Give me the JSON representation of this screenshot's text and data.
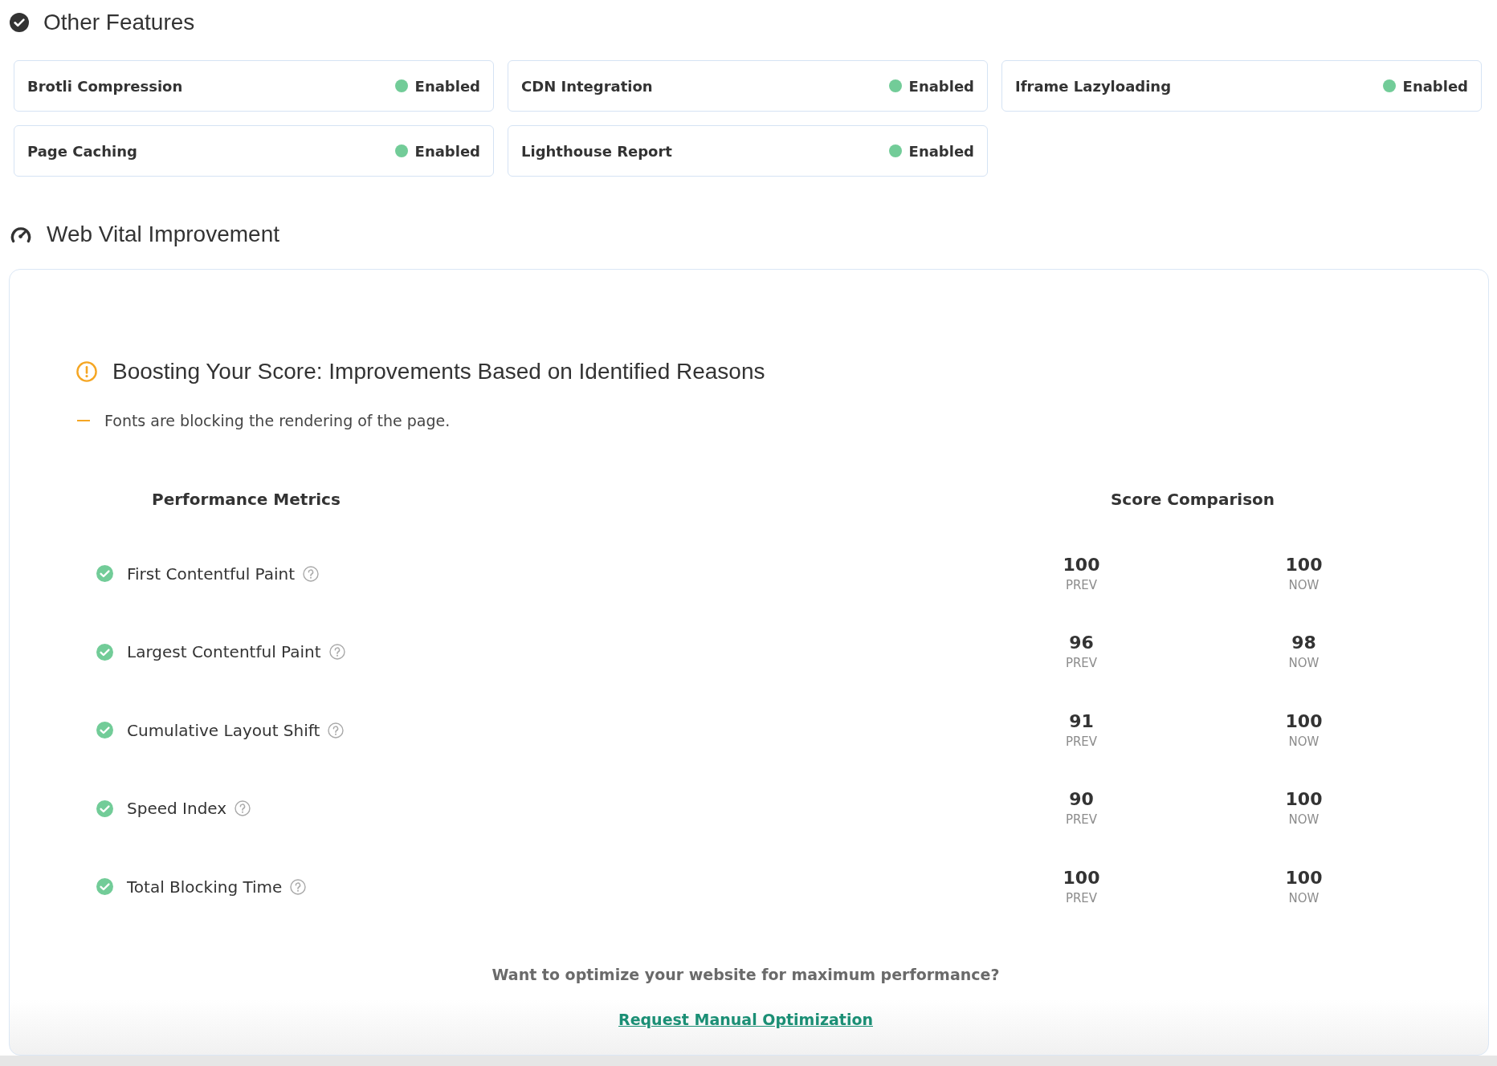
{
  "other_features": {
    "title": "Other Features",
    "items": [
      {
        "name": "Brotli Compression",
        "status": "Enabled",
        "enabled": true
      },
      {
        "name": "CDN Integration",
        "status": "Enabled",
        "enabled": true
      },
      {
        "name": "Iframe Lazyloading",
        "status": "Enabled",
        "enabled": true
      },
      {
        "name": "Page Caching",
        "status": "Enabled",
        "enabled": true
      },
      {
        "name": "Lighthouse Report",
        "status": "Enabled",
        "enabled": true
      }
    ]
  },
  "web_vital": {
    "title": "Web Vital Improvement",
    "notice": {
      "title": "Boosting Your Score: Improvements Based on Identified Reasons",
      "reasons": [
        "Fonts are blocking the rendering of the page."
      ]
    },
    "table": {
      "columns": [
        "Performance Metrics",
        "Score Comparison"
      ],
      "rows": [
        {
          "metric": "First Contentful Paint",
          "passed": true,
          "prev": "100",
          "prev_label": "PREV",
          "now": "100",
          "now_label": "NOW"
        },
        {
          "metric": "Largest Contentful Paint",
          "passed": true,
          "prev": "96",
          "prev_label": "PREV",
          "now": "98",
          "now_label": "NOW"
        },
        {
          "metric": "Cumulative Layout Shift",
          "passed": true,
          "prev": "91",
          "prev_label": "PREV",
          "now": "100",
          "now_label": "NOW"
        },
        {
          "metric": "Speed Index",
          "passed": true,
          "prev": "90",
          "prev_label": "PREV",
          "now": "100",
          "now_label": "NOW"
        },
        {
          "metric": "Total Blocking Time",
          "passed": true,
          "prev": "100",
          "prev_label": "PREV",
          "now": "100",
          "now_label": "NOW"
        }
      ]
    },
    "cta": {
      "text": "Want to optimize your website for maximum performance?",
      "link": "Request Manual Optimization"
    }
  }
}
